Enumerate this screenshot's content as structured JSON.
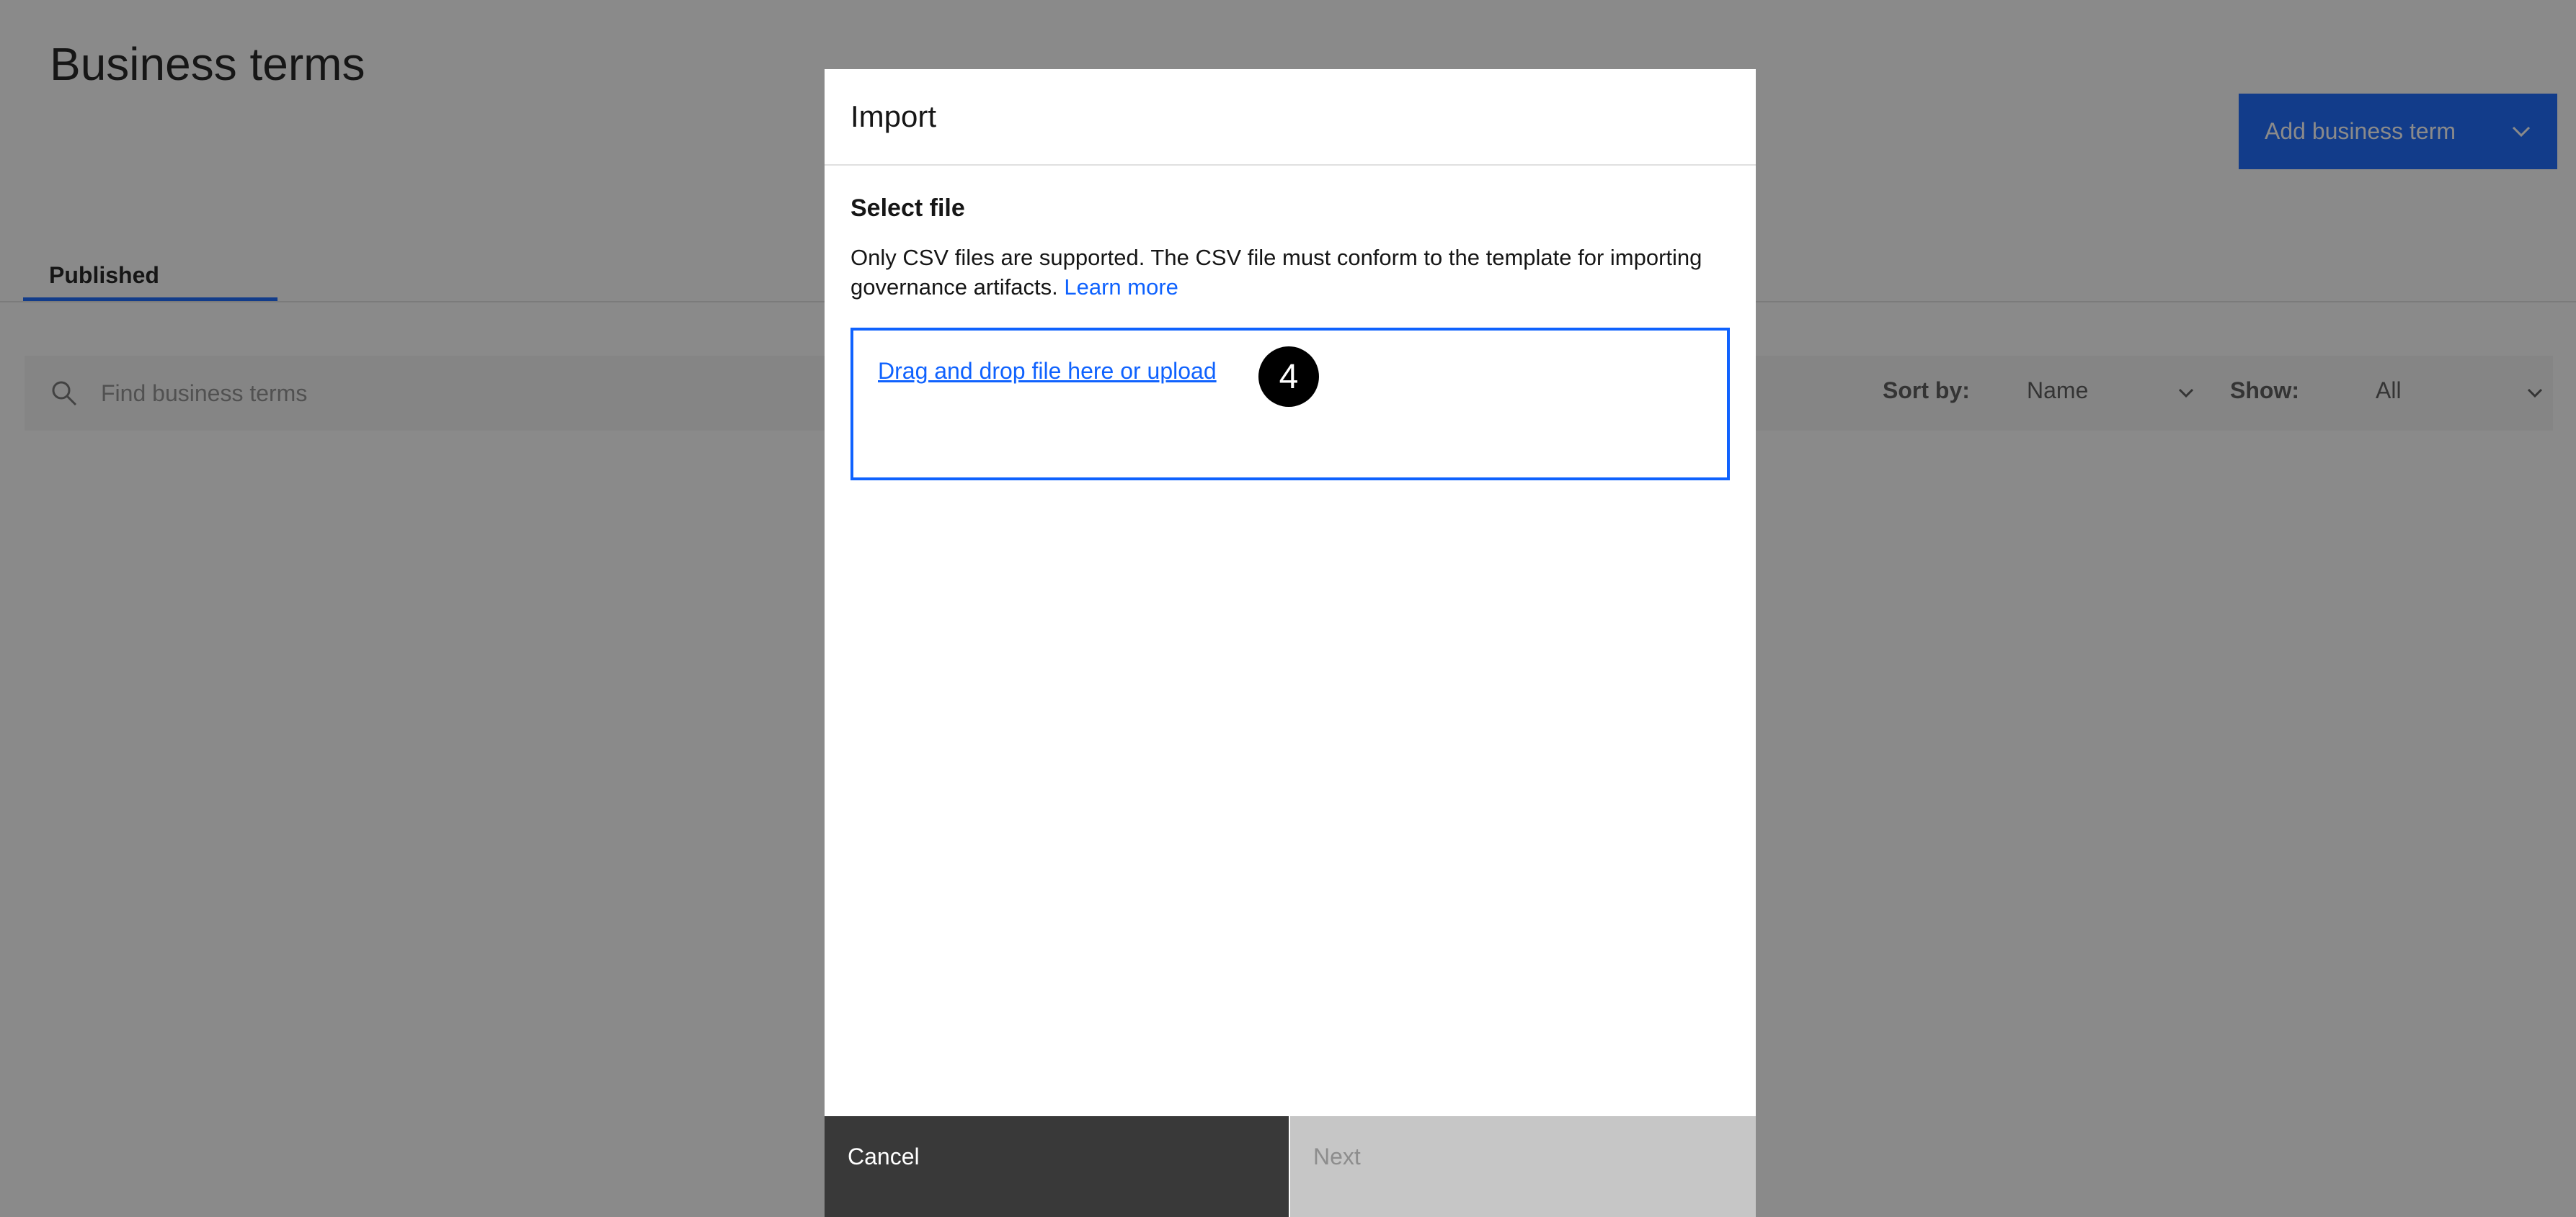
{
  "page": {
    "title": "Business terms",
    "add_button_label": "Add business term",
    "tabs": [
      {
        "label": "Published",
        "active": true
      }
    ],
    "search": {
      "placeholder": "Find business terms"
    },
    "sort": {
      "label": "Sort by:",
      "value": "Name"
    },
    "show": {
      "label": "Show:",
      "value": "All"
    }
  },
  "modal": {
    "title": "Import",
    "section_title": "Select file",
    "description": "Only CSV files are supported. The CSV file must conform to the template for importing governance artifacts.",
    "learn_more": "Learn more",
    "dropzone_text": "Drag and drop file here or upload",
    "step_badge": "4",
    "cancel_label": "Cancel",
    "next_label": "Next",
    "next_disabled": true
  },
  "colors": {
    "accent": "#0f62fe",
    "overlay": "rgba(22,22,22,0.5)",
    "cancel_bg": "#393939",
    "next_disabled_bg": "#c6c6c6"
  },
  "icons": [
    "search-icon",
    "chevron-down-icon"
  ]
}
